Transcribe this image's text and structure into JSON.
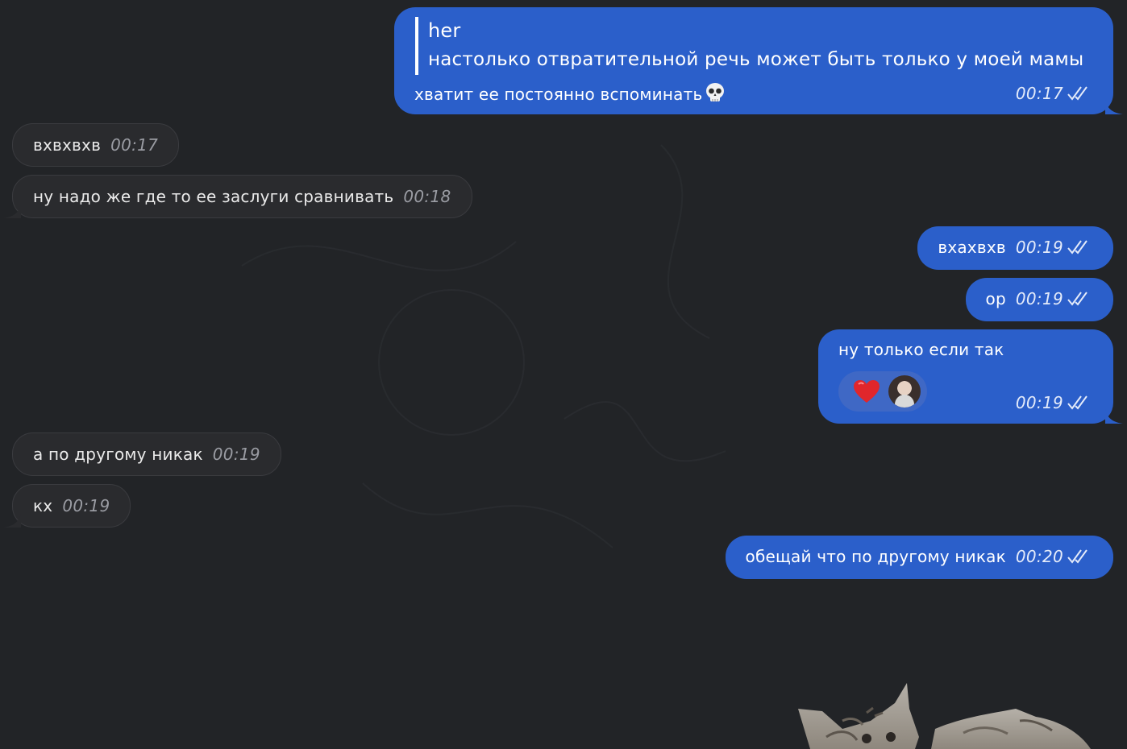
{
  "messages": [
    {
      "id": "m1",
      "direction": "outgoing",
      "reply": {
        "author": "her",
        "text": "настолько отвратительной речь может быть только у моей мамы"
      },
      "text": "хватит ее постоянно вспоминать",
      "emoji": "skull-emoji",
      "time": "00:17",
      "status": "read"
    },
    {
      "id": "m2",
      "direction": "incoming",
      "text": "вхвхвхв",
      "time": "00:17"
    },
    {
      "id": "m3",
      "direction": "incoming",
      "text": "ну надо же где то ее заслуги сравнивать",
      "time": "00:18"
    },
    {
      "id": "m4",
      "direction": "outgoing",
      "text": "вхахвхв",
      "time": "00:19",
      "status": "read"
    },
    {
      "id": "m5",
      "direction": "outgoing",
      "text": "ор",
      "time": "00:19",
      "status": "read"
    },
    {
      "id": "m6",
      "direction": "outgoing",
      "text": "ну только если так",
      "reaction": {
        "emoji": "heart-emoji",
        "reactor": "reactor-avatar"
      },
      "time": "00:19",
      "status": "read"
    },
    {
      "id": "m7",
      "direction": "incoming",
      "text": "а по другому никак",
      "time": "00:19"
    },
    {
      "id": "m8",
      "direction": "incoming",
      "text": "кх",
      "time": "00:19"
    },
    {
      "id": "m9",
      "direction": "outgoing",
      "text": "обещай что по другому никак",
      "time": "00:20",
      "status": "read"
    }
  ],
  "sticker": {
    "icon": "kitten-sticker"
  },
  "colors": {
    "background": "#222427",
    "incoming_bubble": "#2a2b2e",
    "outgoing_bubble": "#2b5fca",
    "reaction_pill": "#3f68c5"
  }
}
